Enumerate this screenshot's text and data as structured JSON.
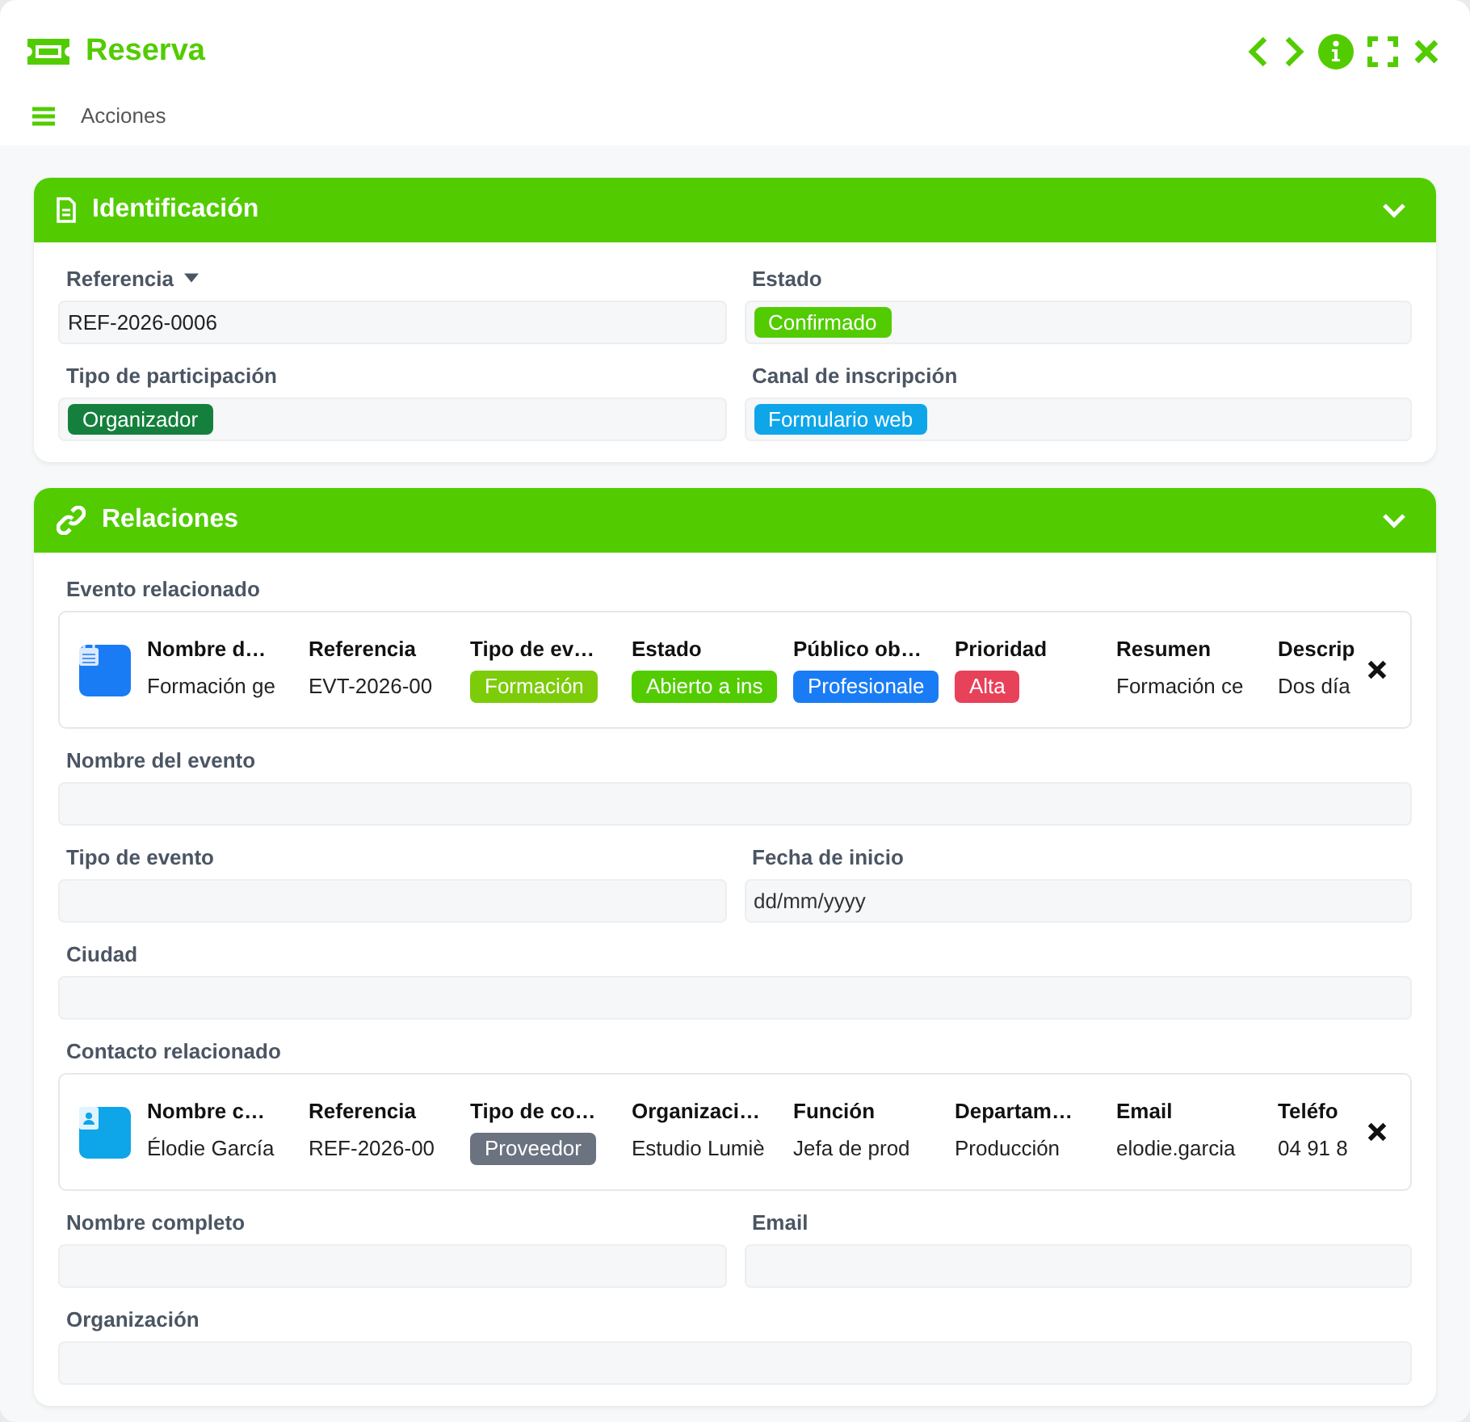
{
  "window": {
    "title": "Reserva"
  },
  "toolbar": {
    "label": "Acciones"
  },
  "sections": [
    {
      "title": "Identificación",
      "expanded": true,
      "rows": [
        {
          "kind": "fields",
          "fields": [
            {
              "label": "Referencia",
              "dropdown": true,
              "value": "REF-2026-0006"
            },
            {
              "label": "Estado",
              "badge": {
                "text": "Confirmado",
                "color": "#52cc00"
              }
            }
          ]
        },
        {
          "kind": "fields",
          "fields": [
            {
              "label": "Tipo de participación",
              "badge": {
                "text": "Organizador",
                "color": "#15803d"
              }
            },
            {
              "label": "Canal de inscripción",
              "badge": {
                "text": "Formulario web",
                "color": "#0ea5e9"
              }
            }
          ]
        }
      ]
    },
    {
      "title": "Relaciones",
      "expanded": true,
      "rows": [
        {
          "kind": "reference",
          "label": "Evento relacionado",
          "columns": [
            {
              "header": "Nombre d…",
              "kind": "text",
              "value": "Formación ge"
            },
            {
              "header": "Referencia",
              "kind": "text",
              "value": "EVT-2026-00"
            },
            {
              "header": "Tipo de ev…",
              "kind": "badge",
              "value": "Formación",
              "color": "#7ccc0a"
            },
            {
              "header": "Estado",
              "kind": "badge",
              "value": "Abierto a ins",
              "color": "#52cc00"
            },
            {
              "header": "Público ob…",
              "kind": "badge",
              "value": "Profesionale",
              "color": "#1a7cf5"
            },
            {
              "header": "Prioridad",
              "kind": "badge",
              "value": "Alta",
              "color": "#e8415a"
            },
            {
              "header": "Resumen",
              "kind": "text",
              "value": "Formación ce"
            },
            {
              "header": "Descrip",
              "kind": "text",
              "value": "Dos día"
            }
          ]
        },
        {
          "kind": "fields",
          "fields": [
            {
              "label": "Nombre del evento"
            }
          ]
        },
        {
          "kind": "fields",
          "fields": [
            {
              "label": "Tipo de evento"
            },
            {
              "label": "Fecha de inicio",
              "placeholder": "dd/mm/yyyy"
            }
          ]
        },
        {
          "kind": "fields",
          "fields": [
            {
              "label": "Ciudad"
            }
          ]
        },
        {
          "kind": "reference",
          "label": "Contacto relacionado",
          "columns": [
            {
              "header": "Nombre c…",
              "kind": "text",
              "value": "Élodie García"
            },
            {
              "header": "Referencia",
              "kind": "text",
              "value": "REF-2026-00"
            },
            {
              "header": "Tipo de co…",
              "kind": "badge",
              "value": "Proveedor",
              "color": "#6b7280"
            },
            {
              "header": "Organizaci…",
              "kind": "text",
              "value": "Estudio Lumiè"
            },
            {
              "header": "Función",
              "kind": "text",
              "value": "Jefa de prod"
            },
            {
              "header": "Departam…",
              "kind": "text",
              "value": "Producción"
            },
            {
              "header": "Email",
              "kind": "text",
              "value": "elodie.garcia"
            },
            {
              "header": "Teléfo",
              "kind": "text",
              "value": "04 91 8"
            }
          ]
        },
        {
          "kind": "fields",
          "fields": [
            {
              "label": "Nombre completo"
            },
            {
              "label": "Email"
            }
          ]
        },
        {
          "kind": "fields",
          "fields": [
            {
              "label": "Organización"
            }
          ]
        }
      ]
    }
  ]
}
